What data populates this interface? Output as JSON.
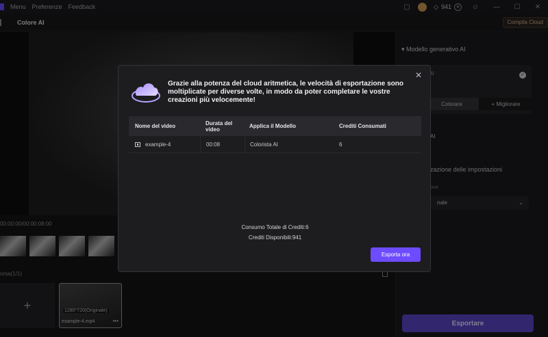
{
  "titlebar": {
    "menus": [
      "Menu",
      "Preferenze",
      "Feedback"
    ],
    "credits": "941"
  },
  "toolbar": {
    "title": "Colore AI",
    "cloud_button": "Compila Cloud"
  },
  "preview": {
    "timecode": "00:00:00/00:00:08:00"
  },
  "media": {
    "label": "orsa(1/1)",
    "resolution": "1280*720(Originale)",
    "filename": "example-4.mp4"
  },
  "right_panel": {
    "header": "Modello generativo AI",
    "card_label": "a AI",
    "seg_a": "Colorare",
    "seg_b": "+ Migliorare",
    "sub1": "AI",
    "sub2": "zazione delle impostazioni",
    "sub3": "one",
    "select_value": "nale",
    "export_label": "Esportare"
  },
  "modal": {
    "message": "Grazie alla potenza del cloud aritmetica, le velocità di esportazione sono moltiplicate per diverse volte, in modo da poter completare le vostre creazioni più velocemente!",
    "headers": [
      "Nome del video",
      "Durata del video",
      "Applica il Modello",
      "Crediti Consumati"
    ],
    "row": [
      "example-4",
      "00:08",
      "Colorista AI",
      "6"
    ],
    "total": "Consumo Totale di Crediti:6",
    "available": "Crediti Disponibili:941",
    "export_button": "Esporta ora"
  },
  "colors": {
    "accent": "#6d4cff",
    "export": "#5c45c9"
  }
}
